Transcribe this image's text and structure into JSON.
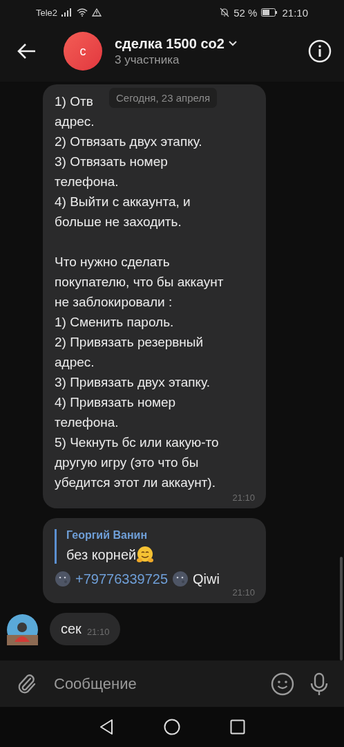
{
  "status_bar": {
    "carrier": "Tele2",
    "battery": "52 %",
    "time": "21:10"
  },
  "header": {
    "avatar_letter": "с",
    "title": "сделка 1500 со2",
    "subtitle": "3 участника"
  },
  "date_pill": "Сегодня, 23 апреля",
  "messages": [
    {
      "kind": "text",
      "paragraphs": [
        [
          "1) Отв",
          "адрес.",
          "2) Отвязать двух этапку.",
          "3) Отвязать номер",
          "телефона.",
          "4) Выйти с аккаунта, и",
          "больше не заходить."
        ],
        [
          "Что нужно сделать",
          "покупателю, что бы аккаунт",
          "не заблокировали :",
          "1) Сменить пароль.",
          "2) Привязать резервный",
          "адрес.",
          "3) Привязать двух этапку.",
          "4) Привязать номер",
          "телефона.",
          "5) Чекнуть бс или какую-то",
          "другую игру (это что бы",
          "убедится этот ли аккаунт)."
        ]
      ],
      "time": "21:10"
    },
    {
      "kind": "reply",
      "quote": {
        "author": "Георгий Ванин",
        "parts": [
          {
            "kind": "text",
            "text": "без корней"
          },
          {
            "kind": "hug"
          }
        ]
      },
      "segments": [
        {
          "kind": "moon"
        },
        {
          "kind": "link",
          "text": "+79776339725"
        },
        {
          "kind": "moon"
        },
        {
          "kind": "text",
          "text": "Qiwi"
        }
      ],
      "time": "21:10"
    },
    {
      "kind": "short",
      "text": "сек",
      "time": "21:10",
      "avatar": true
    }
  ],
  "composer": {
    "placeholder": "Сообщение"
  }
}
